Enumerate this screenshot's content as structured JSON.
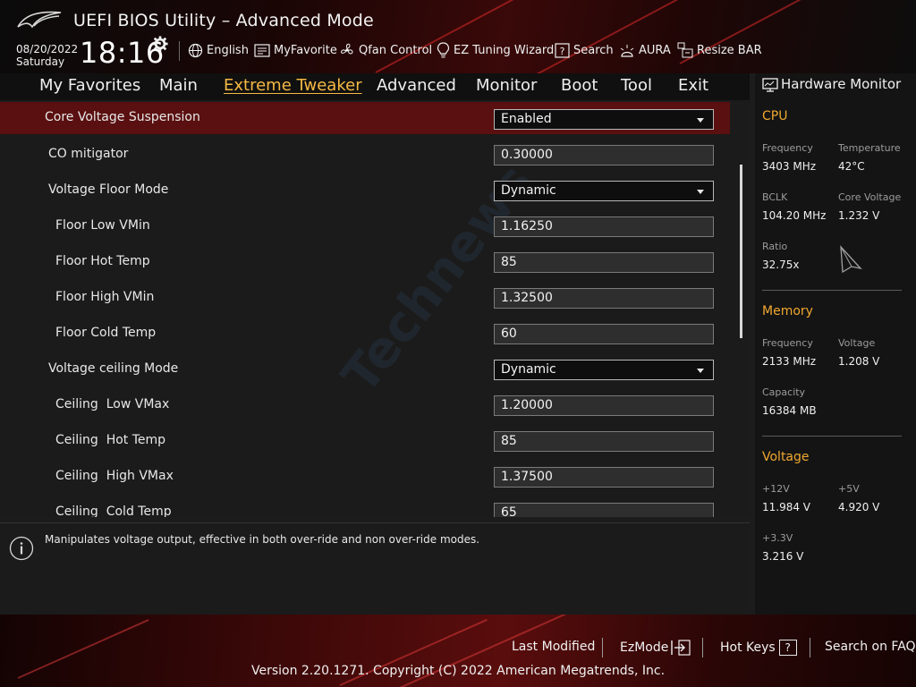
{
  "app": {
    "title": "UEFI BIOS Utility – Advanced Mode"
  },
  "datetime": {
    "date": "08/20/2022",
    "day": "Saturday",
    "time": "18:16"
  },
  "toolbar": {
    "items": [
      {
        "label": "English",
        "icon": "globe-icon"
      },
      {
        "label": "MyFavorite",
        "icon": "favorite-icon"
      },
      {
        "label": "Qfan Control",
        "icon": "fan-icon"
      },
      {
        "label": "EZ Tuning Wizard",
        "icon": "bulb-icon"
      },
      {
        "label": "Search",
        "icon": "help-search-icon"
      },
      {
        "label": "AURA",
        "icon": "aura-icon"
      },
      {
        "label": "Resize BAR",
        "icon": "resize-bar-icon"
      }
    ]
  },
  "menu": {
    "tabs": [
      {
        "label": "My Favorites"
      },
      {
        "label": "Main"
      },
      {
        "label": "Extreme Tweaker",
        "active": true
      },
      {
        "label": "Advanced"
      },
      {
        "label": "Monitor"
      },
      {
        "label": "Boot"
      },
      {
        "label": "Tool"
      },
      {
        "label": "Exit"
      }
    ]
  },
  "settings": {
    "rows": [
      {
        "label": "Core Voltage Suspension",
        "value": "Enabled",
        "type": "dropdown",
        "selected": true
      },
      {
        "label": "CO mitigator",
        "value": "0.30000",
        "type": "input"
      },
      {
        "label": "Voltage Floor Mode",
        "value": "Dynamic",
        "type": "dropdown"
      },
      {
        "label": "Floor Low VMin",
        "value": "1.16250",
        "type": "input"
      },
      {
        "label": "Floor Hot Temp",
        "value": "85",
        "type": "input"
      },
      {
        "label": "Floor High VMin",
        "value": "1.32500",
        "type": "input"
      },
      {
        "label": "Floor Cold Temp",
        "value": "60",
        "type": "input"
      },
      {
        "label": "Voltage ceiling Mode",
        "value": "Dynamic",
        "type": "dropdown"
      },
      {
        "label": "Ceiling  Low VMax",
        "value": "1.20000",
        "type": "input"
      },
      {
        "label": "Ceiling  Hot Temp",
        "value": "85",
        "type": "input"
      },
      {
        "label": "Ceiling  High VMax",
        "value": "1.37500",
        "type": "input"
      },
      {
        "label": "Ceiling  Cold Temp",
        "value": "65",
        "type": "input"
      }
    ]
  },
  "help": {
    "text": "Manipulates voltage output, effective in both over-ride and non over-ride modes."
  },
  "watermark": {
    "text": "Technews"
  },
  "hardware_monitor": {
    "title": "Hardware Monitor",
    "cpu": {
      "heading": "CPU",
      "frequency_label": "Frequency",
      "frequency": "3403 MHz",
      "temperature_label": "Temperature",
      "temperature": "42°C",
      "bclk_label": "BCLK",
      "bclk": "104.20 MHz",
      "core_voltage_label": "Core Voltage",
      "core_voltage": "1.232 V",
      "ratio_label": "Ratio",
      "ratio": "32.75x"
    },
    "memory": {
      "heading": "Memory",
      "frequency_label": "Frequency",
      "frequency": "2133 MHz",
      "voltage_label": "Voltage",
      "voltage": "1.208 V",
      "capacity_label": "Capacity",
      "capacity": "16384 MB"
    },
    "voltage": {
      "heading": "Voltage",
      "v12_label": "+12V",
      "v12": "11.984 V",
      "v5_label": "+5V",
      "v5": "4.920 V",
      "v33_label": "+3.3V",
      "v33": "3.216 V"
    }
  },
  "footer": {
    "last_modified": "Last Modified",
    "ezmode": "EzMode",
    "hot_keys": "Hot Keys",
    "hot_keys_key": "?",
    "search_faq": "Search on FAQ",
    "version": "Version 2.20.1271. Copyright (C) 2022 American Megatrends, Inc."
  },
  "colors": {
    "accent": "#f5b944",
    "selected_row": "#5a1010",
    "section_heading": "#f0a830"
  }
}
